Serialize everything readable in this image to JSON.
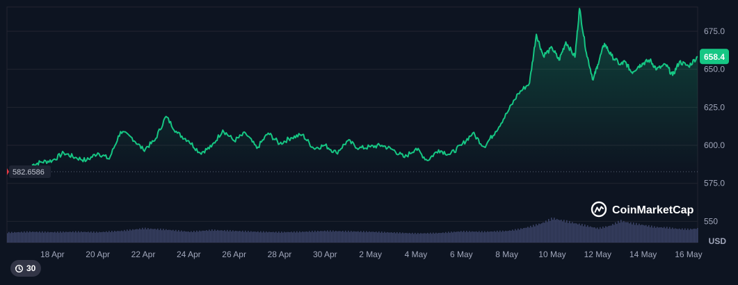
{
  "chart_data": {
    "type": "area",
    "currency_label": "USD",
    "watermark": "CoinMarketCap",
    "current_price": 658.4,
    "current_price_label": "658.4",
    "start_price": 582.6586,
    "start_price_label": "582.6586",
    "ylim": [
      536,
      691
    ],
    "y_ticks": [
      550,
      575,
      600,
      625,
      650,
      675
    ],
    "y_tick_labels": [
      "550",
      "575.0",
      "600.0",
      "625.0",
      "650.0",
      "675.0"
    ],
    "x_tick_labels": [
      "18 Apr",
      "20 Apr",
      "22 Apr",
      "24 Apr",
      "26 Apr",
      "28 Apr",
      "30 Apr",
      "2 May",
      "4 May",
      "6 May",
      "8 May",
      "10 May",
      "12 May",
      "14 May",
      "16 May"
    ],
    "x_tick_days": [
      2,
      4,
      6,
      8,
      10,
      12,
      14,
      16,
      18,
      20,
      22,
      24,
      26,
      28,
      30
    ],
    "x_start": "16 Apr",
    "x_end_day": 30.4,
    "price_days": [
      1.1,
      1.5,
      2.0,
      2.5,
      3.0,
      3.5,
      4.0,
      4.5,
      5.0,
      5.5,
      6.0,
      6.5,
      7.0,
      7.5,
      8.0,
      8.5,
      9.0,
      9.5,
      10.0,
      10.5,
      11.0,
      11.5,
      12.0,
      12.5,
      13.0,
      13.5,
      14.0,
      14.5,
      15.0,
      15.5,
      16.0,
      16.5,
      17.0,
      17.5,
      18.0,
      18.5,
      19.0,
      19.5,
      20.0,
      20.5,
      21.0,
      21.5,
      22.0,
      22.5,
      23.0,
      23.3,
      23.6,
      24.0,
      24.3,
      24.6,
      25.0,
      25.2,
      25.5,
      25.8,
      26.0,
      26.3,
      26.6,
      27.0,
      27.2,
      27.5,
      27.8,
      28.0,
      28.3,
      28.6,
      29.0,
      29.3,
      29.6,
      30.0,
      30.4
    ],
    "price_values": [
      587,
      589,
      590,
      595,
      592,
      590,
      595,
      591,
      609,
      605,
      597,
      603,
      619,
      608,
      603,
      595,
      599,
      610,
      603,
      608,
      598,
      608,
      601,
      605,
      607,
      598,
      600,
      595,
      603,
      598,
      599,
      600,
      597,
      592,
      598,
      590,
      597,
      594,
      600,
      608,
      599,
      609,
      621,
      634,
      641,
      673,
      659,
      664,
      656,
      668,
      658,
      690,
      661,
      643,
      653,
      667,
      659,
      653,
      655,
      648,
      652,
      654,
      656,
      650,
      653,
      646,
      655,
      652,
      658.4
    ],
    "volume_days": [
      0,
      1,
      2,
      3,
      4,
      5,
      6,
      7,
      8,
      9,
      10,
      11,
      12,
      13,
      14,
      15,
      16,
      17,
      18,
      19,
      20,
      21,
      22,
      22.5,
      23,
      23.5,
      24,
      24.5,
      25,
      25.5,
      26,
      26.5,
      27,
      27.5,
      28,
      28.5,
      29,
      29.5,
      30,
      30.4
    ],
    "volume_rel": [
      0.24,
      0.26,
      0.25,
      0.26,
      0.25,
      0.28,
      0.34,
      0.31,
      0.26,
      0.3,
      0.28,
      0.26,
      0.25,
      0.26,
      0.28,
      0.27,
      0.26,
      0.24,
      0.22,
      0.23,
      0.27,
      0.26,
      0.28,
      0.32,
      0.38,
      0.46,
      0.58,
      0.52,
      0.46,
      0.4,
      0.34,
      0.4,
      0.52,
      0.46,
      0.42,
      0.37,
      0.36,
      0.33,
      0.32,
      0.34
    ],
    "colors": {
      "background": "#0d1421",
      "line": "#16c784",
      "grid": "#222531",
      "axis_text": "#a1a7bb",
      "price_badge": "#16c784",
      "start_badge": "#1e2433",
      "start_line": "#5a6378",
      "volume": "#3a4266",
      "watermark": "#ffffff"
    }
  },
  "timeframe_button": {
    "label": "30",
    "icon": "history-icon"
  }
}
